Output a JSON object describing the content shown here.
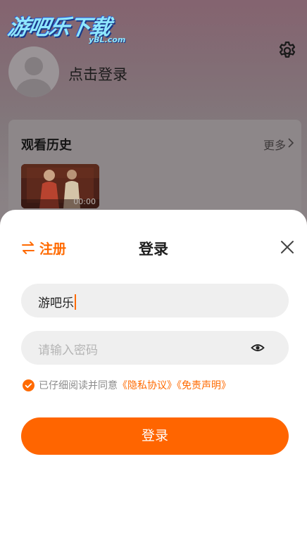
{
  "watermark": {
    "text": "游吧乐下载",
    "sub": "yBL.com"
  },
  "profile": {
    "login_prompt": "点击登录"
  },
  "history": {
    "title": "观看历史",
    "more_label": "更多",
    "items": [
      {
        "duration": "00:00"
      }
    ]
  },
  "sheet": {
    "register_label": "注册",
    "title": "登录",
    "username": {
      "value": "游吧乐"
    },
    "password": {
      "placeholder": "请输入密码"
    },
    "agree_text": "已仔细阅读并同意",
    "privacy_link": "《隐私协议》",
    "disclaimer_link": "《免责声明》",
    "agree_checked": true,
    "login_button": "登录"
  },
  "colors": {
    "accent": "#ff6a00",
    "button": "#ff6500",
    "field_bg": "#efefef"
  },
  "icons": {
    "settings": "gear-icon",
    "register": "swap-arrows-icon",
    "close": "close-icon",
    "password_toggle": "eye-icon",
    "agree": "check-circle-icon",
    "more": "chevron-right-icon"
  }
}
